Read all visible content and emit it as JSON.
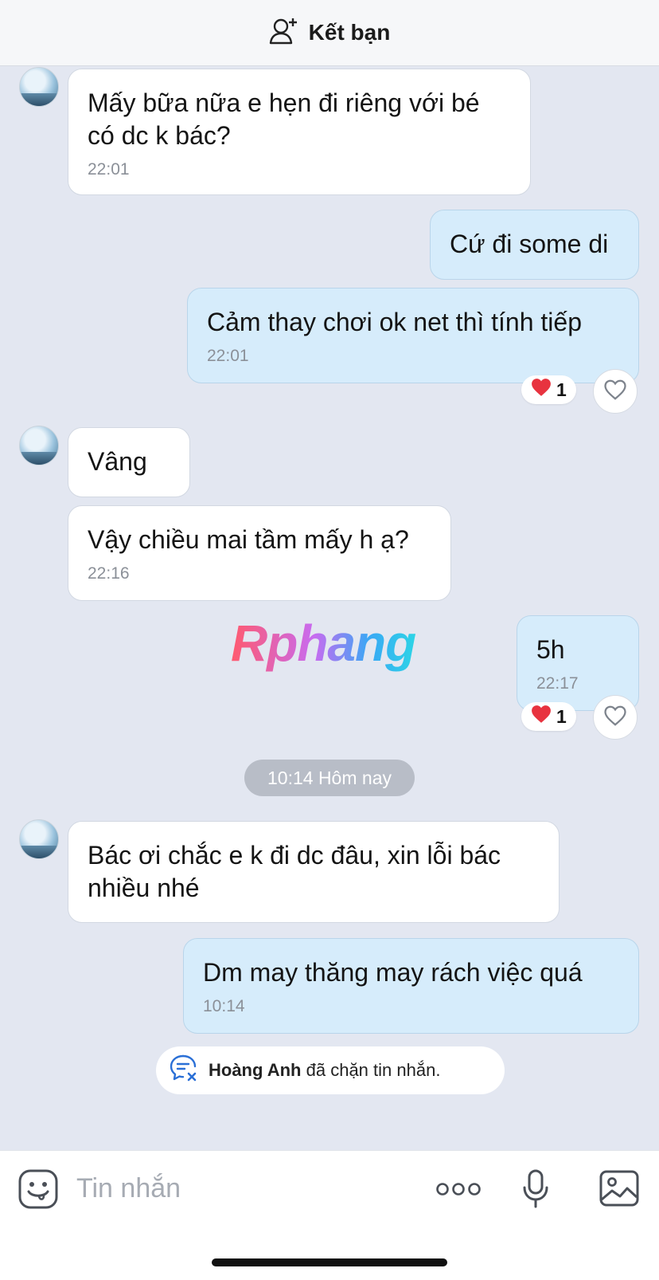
{
  "header": {
    "add_friend_label": "Kết bạn"
  },
  "messages": [
    {
      "text": "Mấy bữa nữa e hẹn đi riêng với bé có dc k bác?",
      "time": "22:01"
    },
    {
      "text": "Cứ đi some di"
    },
    {
      "text": "Cảm thay chơi ok net thì tính tiếp",
      "time": "22:01",
      "reaction_count": "1"
    },
    {
      "text": "Vâng"
    },
    {
      "text": "Vậy chiều mai tầm mấy h ạ?",
      "time": "22:16"
    },
    {
      "text": "5h",
      "time": "22:17",
      "reaction_count": "1"
    },
    {
      "text": "Bác ơi chắc e k đi dc đâu, xin lỗi bác nhiều nhé"
    },
    {
      "text": "Dm may thăng may rách việc quá",
      "time": "10:14"
    }
  ],
  "date_separator": "10:14 Hôm nay",
  "watermark": "Rphang",
  "blocked_notice": {
    "name": "Hoàng Anh",
    "text": "đã chặn tin nhắn."
  },
  "composer": {
    "placeholder": "Tin nhắn"
  },
  "icons": {
    "add_friend": "add-user-icon",
    "reaction": "red-heart-icon",
    "like": "heart-outline-icon",
    "blocked": "chat-blocked-icon",
    "sticker": "sticker-face-icon",
    "more": "more-dots-icon",
    "mic": "microphone-icon",
    "image": "image-icon"
  },
  "colors": {
    "background": "#e3e7f1",
    "incoming_bubble": "#ffffff",
    "outgoing_bubble": "#d6ecfb",
    "heart": "#e8333f",
    "blocked_icon": "#2a6fd6"
  }
}
